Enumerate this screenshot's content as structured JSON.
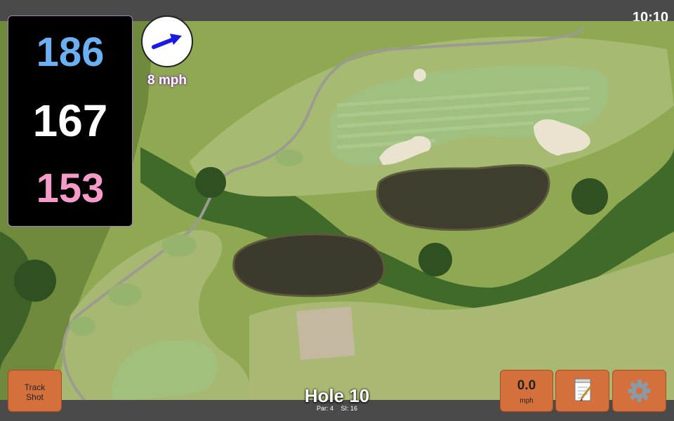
{
  "status_bar": {
    "time": "10:10"
  },
  "yardages": {
    "back": "186",
    "middle": "167",
    "front": "153"
  },
  "wind": {
    "speed": "8 mph",
    "icon": "wind-direction-arrow-icon"
  },
  "hole": {
    "title": "Hole 10",
    "par": "Par: 4",
    "stroke_index": "SI: 16"
  },
  "buttons": {
    "track_shot": "Track\nShot",
    "speed_value": "0.0",
    "speed_unit": "mph",
    "notes_icon": "notepad-icon",
    "settings_icon": "gear-icon"
  },
  "colors": {
    "back_yardage": "#6ab0f2",
    "middle_yardage": "#ffffff",
    "front_yardage": "#f59ac9",
    "button": "#d4703c",
    "wind_arrow": "#1a1ae6"
  }
}
